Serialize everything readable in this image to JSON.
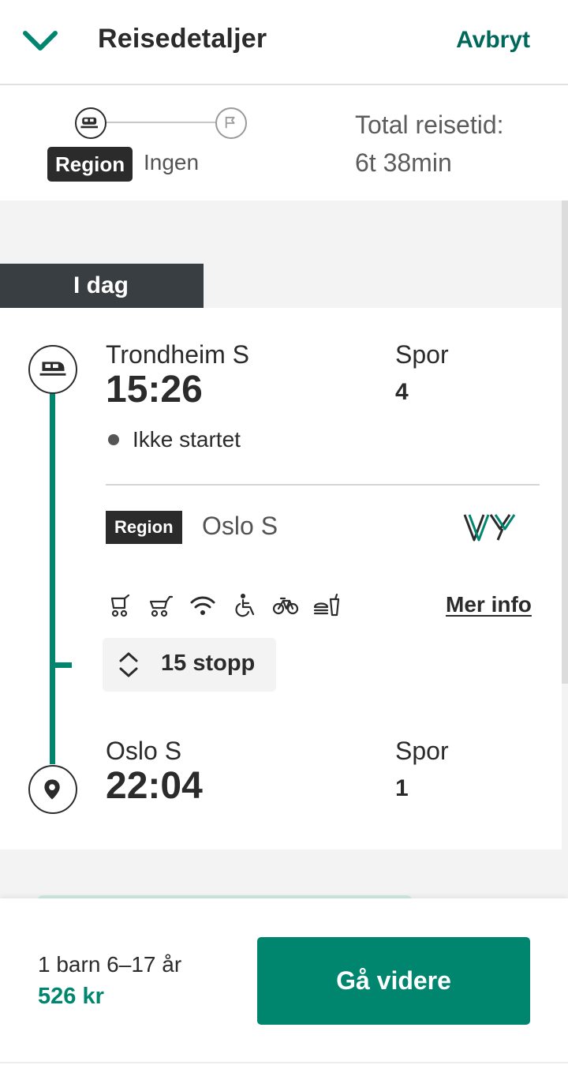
{
  "header": {
    "title": "Reisedetaljer",
    "cancel_label": "Avbryt",
    "back_icon": "chevron-down-icon"
  },
  "summary": {
    "leg_tag": "Region",
    "transfers_text": "Ingen",
    "total_label": "Total reisetid:",
    "total_value": "6t 38min"
  },
  "day_label": "I dag",
  "journey": {
    "departure": {
      "station": "Trondheim S",
      "time": "15:26",
      "track_label": "Spor",
      "track": "4",
      "status": "Ikke startet"
    },
    "leg": {
      "product": "Region",
      "destination": "Oslo S",
      "operator_logo": "vy-logo",
      "amenities": [
        "stroller-icon",
        "stroller-icon",
        "wifi-icon",
        "wheelchair-icon",
        "bicycle-icon",
        "food-drink-icon"
      ],
      "more_info_label": "Mer info",
      "stops_label": "15 stopp"
    },
    "arrival": {
      "station": "Oslo S",
      "time": "22:04",
      "track_label": "Spor",
      "track": "1"
    }
  },
  "footer": {
    "passengers": "1 barn 6–17 år",
    "price": "526 kr",
    "continue_label": "Gå videre"
  },
  "colors": {
    "accent": "#00866f",
    "accent_dark": "#00685a",
    "dark": "#2b2b2c",
    "day_tab": "#383e42"
  }
}
